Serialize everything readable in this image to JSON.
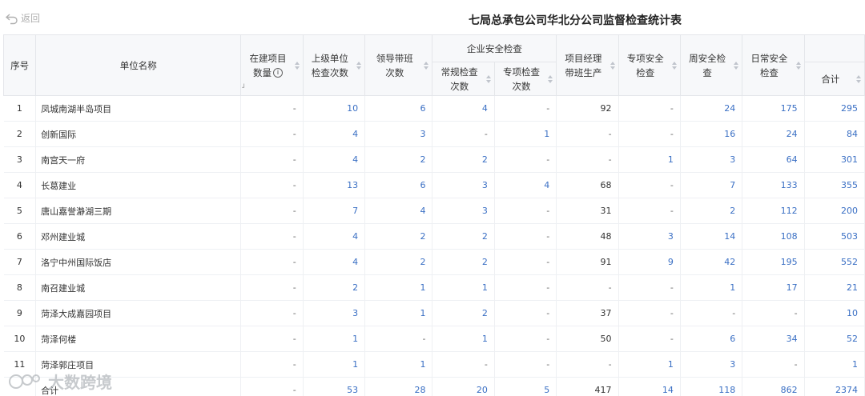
{
  "header": {
    "back_label": "返回",
    "title": "七局总承包公司华北分公司监督检查统计表"
  },
  "columns": {
    "index": "序号",
    "unit": "单位名称",
    "projects_line1": "在建项目",
    "projects_line2": "数量",
    "info_symbol": "i",
    "superior_line1": "上级单位",
    "superior_line2": "检查次数",
    "leader_line1": "领导带班",
    "leader_line2": "次数",
    "enterprise_group": "企业安全检查",
    "routine_line1": "常规检查",
    "routine_line2": "次数",
    "special_line1": "专项检查",
    "special_line2": "次数",
    "pm_line1": "项目经理",
    "pm_line2": "带班生产",
    "special_safety_line1": "专项安全",
    "special_safety_line2": "检查",
    "weekly_line1": "周安全检",
    "weekly_line2": "查",
    "daily_line1": "日常安全",
    "daily_line2": "检查",
    "total": "合计"
  },
  "rows": [
    {
      "idx": "1",
      "name": "凤城南湖半岛项目",
      "projects": "-",
      "superior": "10",
      "leader": "6",
      "routine": "4",
      "special": "-",
      "pm": "92",
      "special_safety": "-",
      "weekly": "24",
      "daily": "175",
      "total": "295"
    },
    {
      "idx": "2",
      "name": "创新国际",
      "projects": "-",
      "superior": "4",
      "leader": "3",
      "routine": "-",
      "special": "1",
      "pm": "-",
      "special_safety": "-",
      "weekly": "16",
      "daily": "24",
      "total": "84"
    },
    {
      "idx": "3",
      "name": "南宫天一府",
      "projects": "-",
      "superior": "4",
      "leader": "2",
      "routine": "2",
      "special": "-",
      "pm": "-",
      "special_safety": "1",
      "weekly": "3",
      "daily": "64",
      "total": "301"
    },
    {
      "idx": "4",
      "name": "长葛建业",
      "projects": "-",
      "superior": "13",
      "leader": "6",
      "routine": "3",
      "special": "4",
      "pm": "68",
      "special_safety": "-",
      "weekly": "7",
      "daily": "133",
      "total": "355"
    },
    {
      "idx": "5",
      "name": "唐山嘉誉瀞湖三期",
      "projects": "-",
      "superior": "7",
      "leader": "4",
      "routine": "3",
      "special": "-",
      "pm": "31",
      "special_safety": "-",
      "weekly": "2",
      "daily": "112",
      "total": "200"
    },
    {
      "idx": "6",
      "name": "邓州建业城",
      "projects": "-",
      "superior": "4",
      "leader": "2",
      "routine": "2",
      "special": "-",
      "pm": "48",
      "special_safety": "3",
      "weekly": "14",
      "daily": "108",
      "total": "503"
    },
    {
      "idx": "7",
      "name": "洛宁中州国际饭店",
      "projects": "-",
      "superior": "4",
      "leader": "2",
      "routine": "2",
      "special": "-",
      "pm": "91",
      "special_safety": "9",
      "weekly": "42",
      "daily": "195",
      "total": "552"
    },
    {
      "idx": "8",
      "name": "南召建业城",
      "projects": "-",
      "superior": "2",
      "leader": "1",
      "routine": "1",
      "special": "-",
      "pm": "-",
      "special_safety": "-",
      "weekly": "1",
      "daily": "17",
      "total": "21"
    },
    {
      "idx": "9",
      "name": "菏泽大成嘉园项目",
      "projects": "-",
      "superior": "3",
      "leader": "1",
      "routine": "2",
      "special": "-",
      "pm": "37",
      "special_safety": "-",
      "weekly": "-",
      "daily": "-",
      "total": "10"
    },
    {
      "idx": "10",
      "name": "菏泽何楼",
      "projects": "-",
      "superior": "1",
      "leader": "-",
      "routine": "1",
      "special": "-",
      "pm": "50",
      "special_safety": "-",
      "weekly": "6",
      "daily": "34",
      "total": "52"
    },
    {
      "idx": "11",
      "name": "菏泽郭庄项目",
      "projects": "-",
      "superior": "1",
      "leader": "1",
      "routine": "-",
      "special": "-",
      "pm": "-",
      "special_safety": "1",
      "weekly": "3",
      "daily": "-",
      "total": "1"
    }
  ],
  "summary": {
    "name": "合计",
    "projects": "-",
    "superior": "53",
    "leader": "28",
    "routine": "20",
    "special": "5",
    "pm": "417",
    "special_safety": "14",
    "weekly": "118",
    "daily": "862",
    "total": "2374"
  },
  "watermark": {
    "text": "大数跨境"
  },
  "colors": {
    "link": "#3a6fc4",
    "header_bg": "#f7f8fa"
  }
}
